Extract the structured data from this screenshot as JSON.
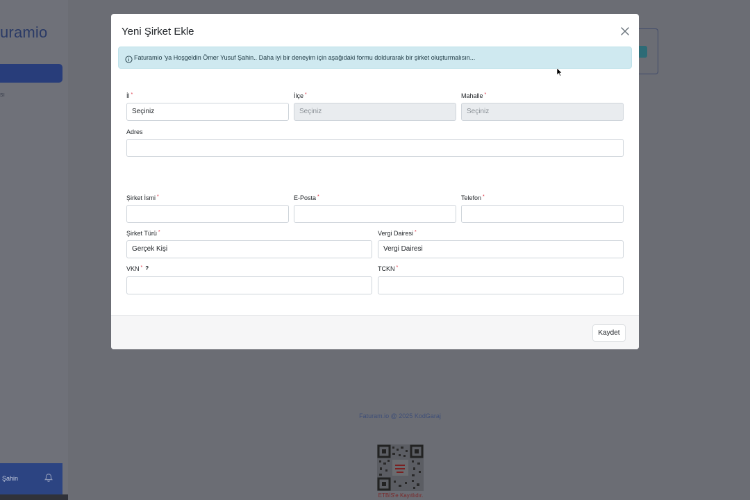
{
  "app": {
    "logo_text": "uramio",
    "nav_fragment": "sı",
    "footer_user": "Şahin",
    "copyright": "Faturam.io @ 2025 KodGaraj",
    "etbis_text": "ETBİS'e Kayıtlıdır."
  },
  "modal": {
    "title": "Yeni Şirket Ekle",
    "alert_text": "Faturamio 'ya Hoşgeldin Ömer Yusuf Şahin.. Daha iyi bir deneyim için aşağıdaki formu doldurarak bir şirket oluşturmalısın...",
    "fields": {
      "il": {
        "label": "İl",
        "value": "Seçiniz"
      },
      "ilce": {
        "label": "İlçe",
        "value": "Seçiniz"
      },
      "mahalle": {
        "label": "Mahalle",
        "value": "Seçiniz"
      },
      "adres": {
        "label": "Adres",
        "value": ""
      },
      "sirket_ismi": {
        "label": "Şirket İsmi",
        "value": ""
      },
      "eposta": {
        "label": "E-Posta",
        "value": ""
      },
      "telefon": {
        "label": "Telefon",
        "value": ""
      },
      "sirket_turu": {
        "label": "Şirket Türü",
        "value": "Gerçek Kişi"
      },
      "vergi_dairesi": {
        "label": "Vergi Dairesi",
        "value": "Vergi Dairesi"
      },
      "vkn": {
        "label": "VKN",
        "help": "?",
        "value": ""
      },
      "tckn": {
        "label": "TCKN",
        "value": ""
      }
    },
    "required_mark": "*",
    "save_label": "Kaydet"
  },
  "icons": {
    "close": "close-icon",
    "info": "info-icon",
    "bell": "bell-icon"
  }
}
